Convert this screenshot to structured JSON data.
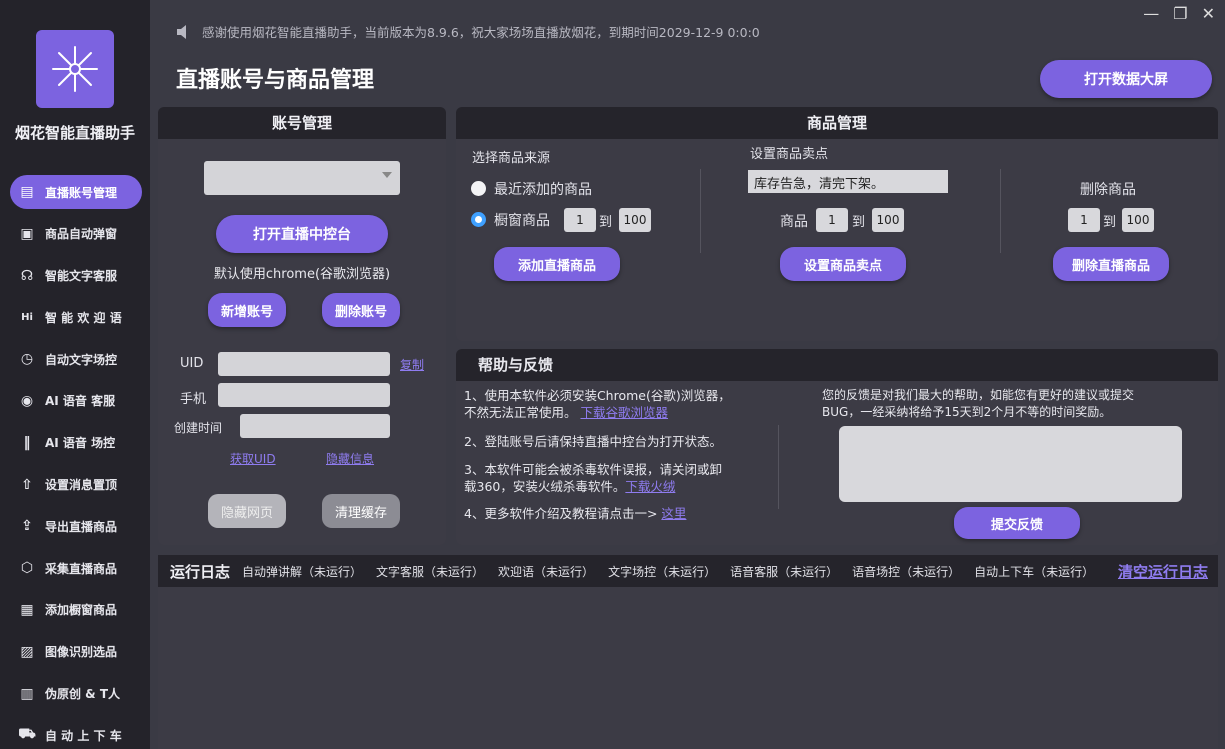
{
  "app": {
    "name": "烟花智能直播助手",
    "notice": "感谢使用烟花智能直播助手，当前版本为8.9.6，祝大家场场直播放烟花，到期时间2029-12-9 0:0:0",
    "page_title": "直播账号与商品管理",
    "dashboard_button": "打开数据大屏",
    "window_controls": [
      "—",
      "❐",
      "✕"
    ]
  },
  "sidebar": {
    "items": [
      {
        "label": "直播账号管理",
        "icon": "id-card-icon",
        "active": true
      },
      {
        "label": "商品自动弹窗",
        "icon": "popup-icon",
        "active": false
      },
      {
        "label": "智能文字客服",
        "icon": "headset-icon",
        "active": false
      },
      {
        "label": "智 能 欢 迎 语",
        "icon": "hi-icon",
        "active": false
      },
      {
        "label": "自动文字场控",
        "icon": "clock-icon",
        "active": false
      },
      {
        "label": "AI 语音 客服",
        "icon": "ai-voice-icon",
        "active": false
      },
      {
        "label": "AI 语音 场控",
        "icon": "waveform-icon",
        "active": false
      },
      {
        "label": "设置消息置顶",
        "icon": "arrow-up-icon",
        "active": false
      },
      {
        "label": "导出直播商品",
        "icon": "export-icon",
        "active": false
      },
      {
        "label": "采集直播商品",
        "icon": "box-icon",
        "active": false
      },
      {
        "label": "添加橱窗商品",
        "icon": "window-icon",
        "active": false
      },
      {
        "label": "图像识别选品",
        "icon": "image-icon",
        "active": false
      },
      {
        "label": "伪原创 & T人",
        "icon": "doc-icon",
        "active": false
      },
      {
        "label": "自 动 上 下 车",
        "icon": "cart-icon",
        "active": false
      }
    ]
  },
  "account": {
    "title": "账号管理",
    "select_value": "",
    "open_console": "打开直播中控台",
    "browser_note": "默认使用chrome(谷歌浏览器)",
    "add_account": "新增账号",
    "delete_account": "删除账号",
    "uid_label": "UID",
    "copy": "复制",
    "phone_label": "手机",
    "created_label": "创建时间",
    "get_uid": "获取UID",
    "hide_info": "隐藏信息",
    "hide_page": "隐藏网页",
    "clear_cache": "清理缓存"
  },
  "goods": {
    "title": "商品管理",
    "source_title": "选择商品来源",
    "option_recent": "最近添加的商品",
    "option_window": "橱窗商品",
    "range_from": "1",
    "range_to_label": "到",
    "range_to": "100",
    "add_live": "添加直播商品",
    "selling_title": "设置商品卖点",
    "selling_text": "库存告急，清完下架。",
    "goods_label": "商品",
    "set_selling": "设置商品卖点",
    "delete_title": "删除商品",
    "delete_live": "删除直播商品"
  },
  "help": {
    "title": "帮助与反馈",
    "line1": "1、使用本软件必须安装Chrome(谷歌)浏览器，",
    "line1b": "不然无法正常使用。",
    "link1": "下载谷歌浏览器",
    "line2": "2、登陆账号后请保持直播中控台为打开状态。",
    "line3": "3、本软件可能会被杀毒软件误报，请关闭或卸",
    "line3b": "载360，安装火绒杀毒软件。",
    "link3": "下载火绒",
    "line4": "4、更多软件介绍及教程请点击一>",
    "link4": "这里",
    "feedback_note1": "您的反馈是对我们最大的帮助，如能您有更好的建议或提交",
    "feedback_note2": "BUG，一经采纳将给予15天到2个月不等的时间奖励。",
    "submit": "提交反馈"
  },
  "log": {
    "title": "运行日志",
    "items": [
      "自动弹讲解（未运行）",
      "文字客服（未运行）",
      "欢迎语（未运行）",
      "文字场控（未运行）",
      "语音客服（未运行）",
      "语音场控（未运行）",
      "自动上下车（未运行）"
    ],
    "clear": "清空运行日志"
  },
  "colors": {
    "accent": "#7c63e0",
    "link": "#8f7cf0",
    "sidebar": "#24232a"
  }
}
